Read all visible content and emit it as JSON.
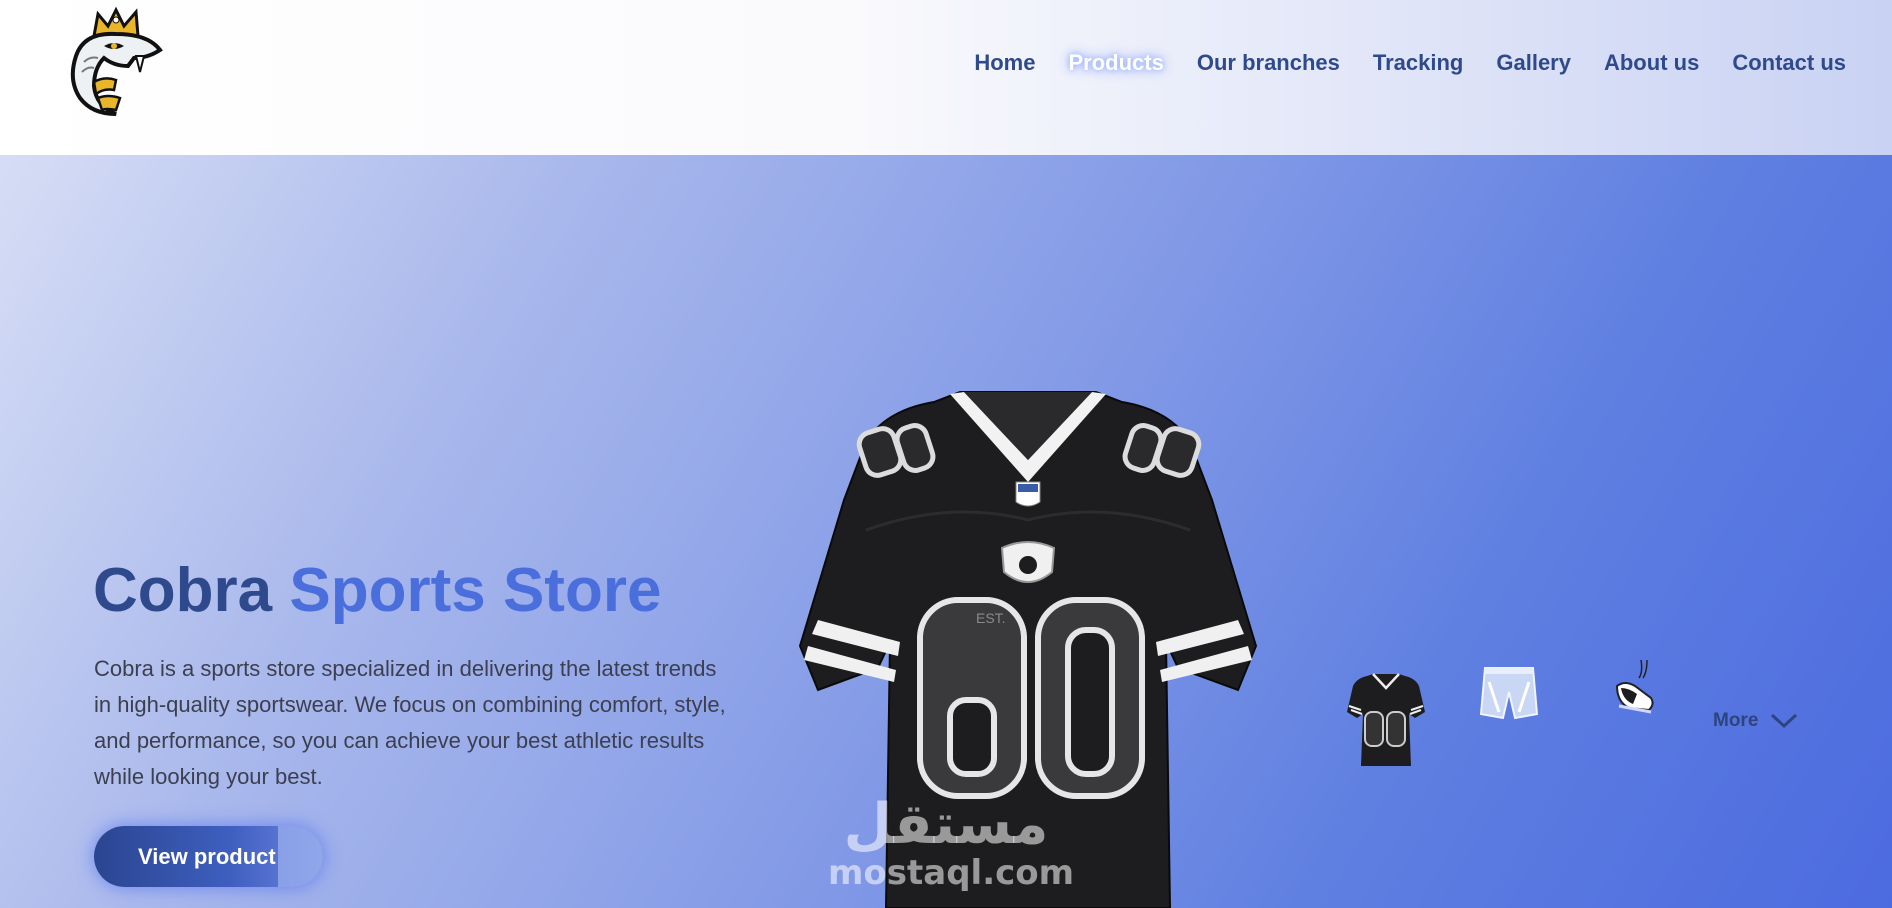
{
  "brand": {
    "logo_icon": "cobra-king-logo-icon"
  },
  "nav": {
    "items": [
      {
        "label": "Home",
        "active": false
      },
      {
        "label": "Products",
        "active": true
      },
      {
        "label": "Our branches",
        "active": false
      },
      {
        "label": "Tracking",
        "active": false
      },
      {
        "label": "Gallery",
        "active": false
      },
      {
        "label": "About us",
        "active": false
      },
      {
        "label": "Contact us",
        "active": false
      }
    ]
  },
  "hero": {
    "title_part1": "Cobra",
    "title_part2": "Sports Store",
    "description": "Cobra is a sports store specialized in delivering the latest trends in high-quality sportswear. We focus on combining comfort, style, and performance, so you can achieve your best athletic results while looking your best.",
    "cta_label": "View product",
    "featured_product": {
      "jersey_number": "60",
      "jersey_mark": "EST.",
      "icon": "football-jersey-image"
    }
  },
  "thumbnails": [
    {
      "icon": "jersey-thumbnail-icon",
      "number": "60"
    },
    {
      "icon": "shorts-thumbnail-icon"
    },
    {
      "icon": "sneakers-thumbnail-icon"
    }
  ],
  "more": {
    "label": "More",
    "icon": "chevron-down-icon"
  },
  "watermark": {
    "arabic": "مستقل",
    "latin": "mostaql.com"
  },
  "colors": {
    "primary": "#2f4a8c",
    "accent": "#4a6fdc",
    "hero_gradient_end": "#4c6be0"
  }
}
